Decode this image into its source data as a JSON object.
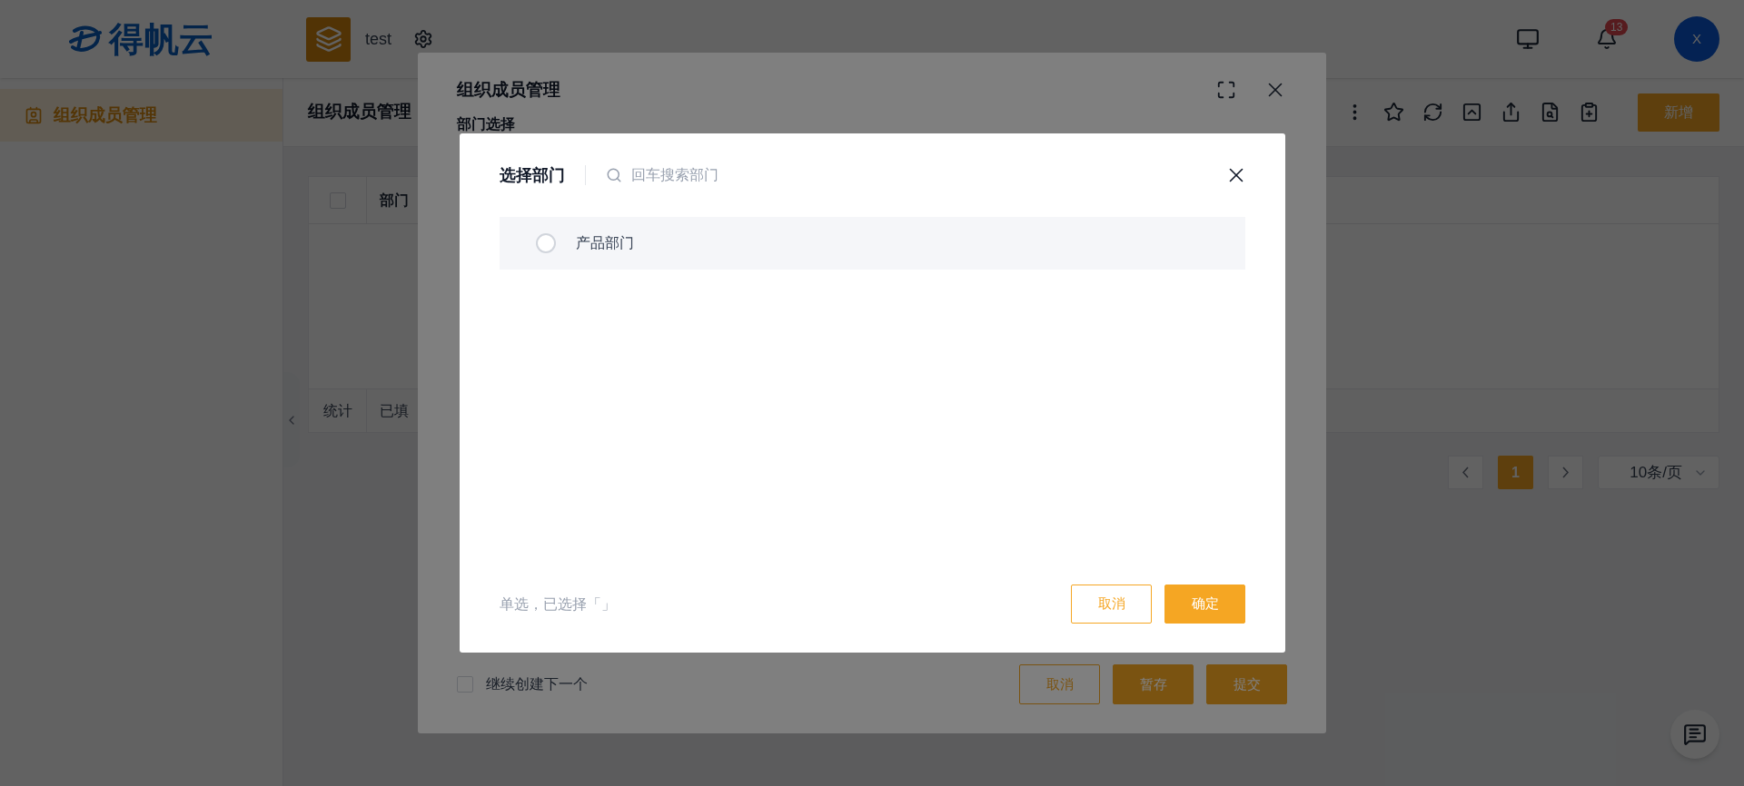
{
  "header": {
    "logo": "得帆云",
    "app_name": "test",
    "notification_count": "13",
    "avatar": "X"
  },
  "sidebar": {
    "items": [
      {
        "label": "组织成员管理",
        "selected": true
      }
    ]
  },
  "main": {
    "title": "组织成员管理",
    "add_button": "新增",
    "table": {
      "header_checkbox": {
        "checked": false
      },
      "columns": [
        "部门"
      ],
      "footer": [
        "统计",
        "已填"
      ]
    },
    "pagination": {
      "pages": [
        {
          "label": "1",
          "selected": true
        }
      ],
      "page_size": "10条/页"
    }
  },
  "form_dialog": {
    "title": "组织成员管理",
    "field_label": "部门选择",
    "continue_checkbox": {
      "label": "继续创建下一个",
      "checked": false
    },
    "buttons": [
      {
        "label": "取消",
        "kind": "outline"
      },
      {
        "label": "暂存",
        "kind": "primary"
      },
      {
        "label": "提交",
        "kind": "primary"
      }
    ]
  },
  "picker_dialog": {
    "title": "选择部门",
    "search": {
      "placeholder": "回车搜索部门"
    },
    "options": [
      {
        "label": "产品部门",
        "selected": false
      }
    ],
    "summary": "单选，已选择「」",
    "buttons": [
      {
        "label": "取消",
        "kind": "outline"
      },
      {
        "label": "确定",
        "kind": "primary"
      }
    ]
  }
}
